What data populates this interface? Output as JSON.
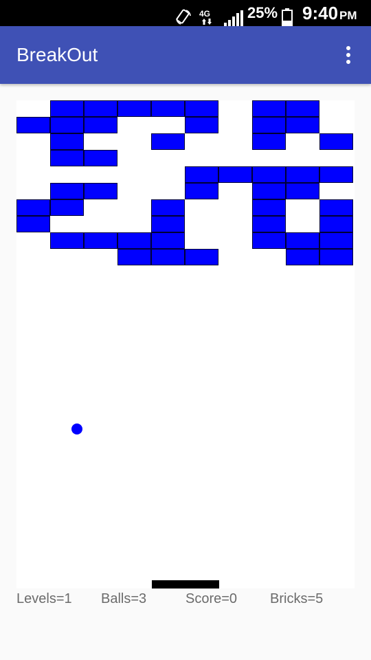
{
  "status_bar": {
    "network": "4G",
    "battery_percent": "25%",
    "time": "9:40",
    "ampm": "PM",
    "icons": [
      "screen-rotate-icon",
      "lte-data-icon",
      "cell-signal-icon",
      "battery-icon"
    ]
  },
  "app_bar": {
    "title": "BreakOut",
    "menu_icon": "overflow-menu-icon",
    "color": "#3f51b5"
  },
  "game": {
    "brick_color": "#0000ff",
    "ball_color": "#0000ff",
    "paddle_color": "#000000",
    "grid": {
      "columns": 10,
      "rows": 10,
      "bricks": [
        [
          0,
          1
        ],
        [
          0,
          2
        ],
        [
          0,
          3
        ],
        [
          0,
          4
        ],
        [
          0,
          5
        ],
        [
          0,
          7
        ],
        [
          0,
          8
        ],
        [
          1,
          0
        ],
        [
          1,
          1
        ],
        [
          1,
          2
        ],
        [
          1,
          5
        ],
        [
          1,
          7
        ],
        [
          1,
          8
        ],
        [
          2,
          1
        ],
        [
          2,
          4
        ],
        [
          2,
          7
        ],
        [
          2,
          9
        ],
        [
          3,
          1
        ],
        [
          3,
          2
        ],
        [
          4,
          5
        ],
        [
          4,
          6
        ],
        [
          4,
          7
        ],
        [
          4,
          8
        ],
        [
          4,
          9
        ],
        [
          5,
          1
        ],
        [
          5,
          2
        ],
        [
          5,
          5
        ],
        [
          5,
          7
        ],
        [
          5,
          8
        ],
        [
          6,
          0
        ],
        [
          6,
          1
        ],
        [
          6,
          4
        ],
        [
          6,
          7
        ],
        [
          6,
          9
        ],
        [
          7,
          0
        ],
        [
          7,
          4
        ],
        [
          7,
          7
        ],
        [
          7,
          9
        ],
        [
          8,
          1
        ],
        [
          8,
          2
        ],
        [
          8,
          3
        ],
        [
          8,
          4
        ],
        [
          8,
          7
        ],
        [
          8,
          8
        ],
        [
          8,
          9
        ],
        [
          9,
          3
        ],
        [
          9,
          4
        ],
        [
          9,
          5
        ],
        [
          9,
          8
        ],
        [
          9,
          9
        ]
      ]
    }
  },
  "stats": {
    "levels": "Levels=1",
    "balls": "Balls=3",
    "score": "Score=0",
    "bricks": "Bricks=5"
  }
}
